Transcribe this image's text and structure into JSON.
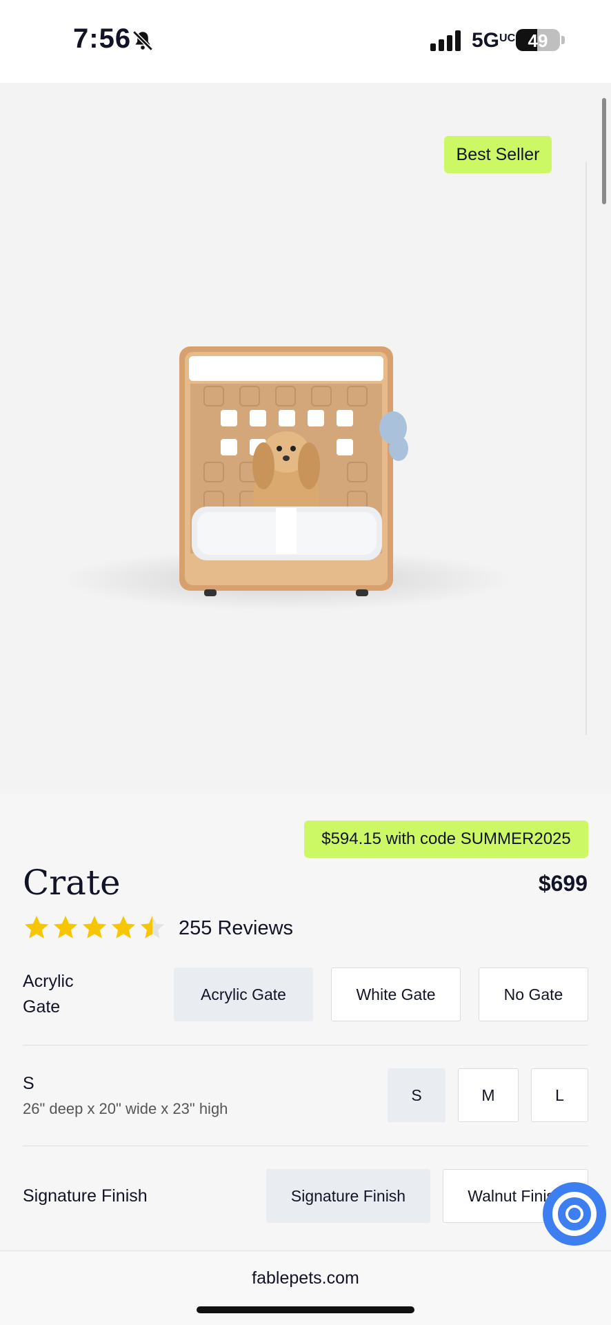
{
  "status_bar": {
    "time": "7:56",
    "network": "5G",
    "network_suffix": "UC",
    "battery_percent": 49
  },
  "hero": {
    "badge": "Best Seller",
    "image_icon": "crate-with-dog-image"
  },
  "product": {
    "promo": "$594.15 with code SUMMER2025",
    "name": "Crate",
    "price": "$699",
    "rating": 4.5,
    "rating_max": 5,
    "reviews": "255 Reviews"
  },
  "options": {
    "gate": {
      "label_line1": "Acrylic",
      "label_line2": "Gate",
      "choices": [
        "Acrylic Gate",
        "White Gate",
        "No Gate"
      ],
      "selected": "Acrylic Gate"
    },
    "size": {
      "label": "S",
      "dimensions": "26\" deep x 20\" wide x 23\" high",
      "choices": [
        "S",
        "M",
        "L"
      ],
      "selected": "S"
    },
    "finish": {
      "label": "Signature Finish",
      "choices": [
        "Signature Finish",
        "Walnut Finish"
      ],
      "selected": "Signature Finish"
    }
  },
  "browser": {
    "url": "fablepets.com"
  },
  "colors": {
    "accent_green": "#cdf865",
    "help_blue": "#3d7ff0",
    "star_gold": "#f7c600",
    "selected_bg": "#e9ecf1"
  }
}
